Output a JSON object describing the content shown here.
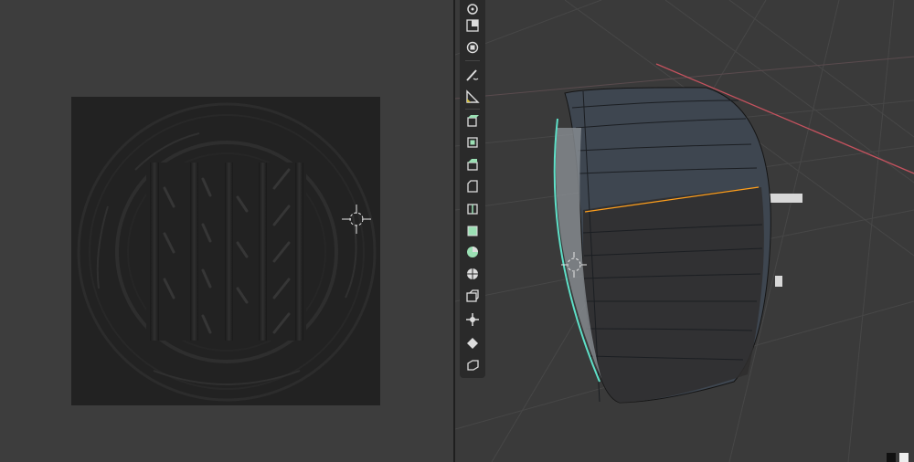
{
  "left_editor": {
    "texture_icon": "tire-normal-map-image",
    "cursor_icon": "3d-cursor-icon"
  },
  "toolbar": {
    "groups": [
      [
        "rotate",
        "scale",
        "transform"
      ],
      [
        "annotate",
        "measure"
      ],
      [
        "add-cube",
        "extrude",
        "inset",
        "bevel",
        "loop-cut",
        "knife",
        "poly-build",
        "spin",
        "smooth",
        "edge-slide",
        "shrink-fatten",
        "shear",
        "rip"
      ]
    ]
  },
  "viewport": {
    "object_icon": "wheel-mesh",
    "cursor_icon": "3d-cursor-icon",
    "selection_color": "#5ee0c8",
    "seam_color": "#ff9f1c",
    "x_axis_color": "#c4525e"
  }
}
